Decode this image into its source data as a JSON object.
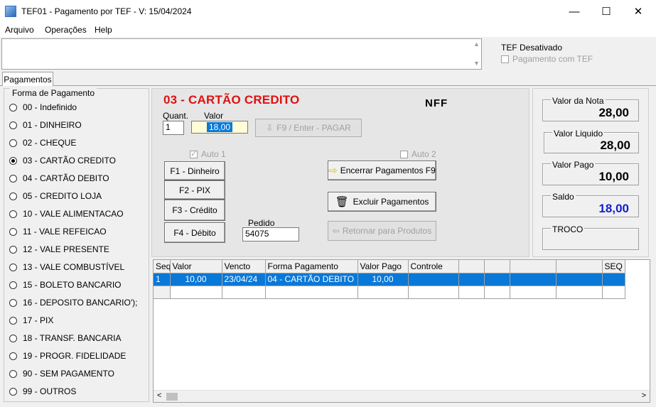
{
  "window": {
    "title": "TEF01 - Pagamento por TEF - V: 15/04/2024",
    "minimize": "—",
    "maximize": "☐",
    "close": "✕"
  },
  "menu": [
    "Arquivo",
    "Operações",
    "Help"
  ],
  "tef": {
    "status": "TEF Desativado",
    "checkbox_label": "Pagamento com TEF"
  },
  "tab": "Pagamentos",
  "forma": {
    "title": "Forma de Pagamento",
    "selected_index": 3,
    "items": [
      "00 - Indefinido",
      "01 - DINHEIRO",
      "02 - CHEQUE",
      "03 - CARTÃO CREDITO",
      "04 - CARTÃO DEBITO",
      "05 - CREDITO LOJA",
      "10 - VALE ALIMENTACAO",
      "11 - VALE REFEICAO",
      "12 - VALE PRESENTE",
      "13 - VALE COMBUSTÍVEL",
      "15 - BOLETO BANCARIO",
      "16 - DEPOSITO BANCARIO');",
      "17 - PIX",
      "18 - TRANSF. BANCARIA",
      "19 - PROGR. FIDELIDADE",
      "90 - SEM PAGAMENTO",
      "99 - OUTROS"
    ]
  },
  "center": {
    "heading": "03 - CARTÃO CREDITO",
    "nff": "NFF",
    "quant_label": "Quant.",
    "quant_value": "1",
    "valor_label": "Valor",
    "valor_value": "18,00",
    "pagar_button": "F9 / Enter - PAGAR",
    "auto1": "Auto 1",
    "auto2": "Auto 2",
    "btn_dinheiro": "F1 - Dinheiro",
    "btn_pix": "F2 -    PIX",
    "btn_credito": "F3 - Crédito",
    "btn_debito": "F4 - Débito",
    "pedido_label": "Pedido",
    "pedido_value": "54075",
    "encerrar": "Encerrar Pagamentos  F9",
    "excluir": "Excluir Pagamentos",
    "retornar": "Retornar para Produtos"
  },
  "totals": {
    "valor_nota_label": "Valor da Nota",
    "valor_nota": "28,00",
    "valor_liquido_label": "Valor Liquido",
    "valor_liquido": "28,00",
    "valor_pago_label": "Valor Pago",
    "valor_pago": "10,00",
    "saldo_label": "Saldo",
    "saldo": "18,00",
    "saldo_color": "#1020d0",
    "troco_label": "TROCO"
  },
  "grid": {
    "columns": [
      "Seq",
      "Valor",
      "Vencto",
      "Forma Pagamento",
      "Valor Pago",
      "Controle",
      "",
      "",
      "",
      "",
      "SEQ"
    ],
    "rows": [
      [
        "1",
        "10,00",
        "23/04/24",
        "04 - CARTÃO DEBITO",
        "10,00",
        "",
        "",
        "",
        "",
        "",
        ""
      ]
    ]
  }
}
